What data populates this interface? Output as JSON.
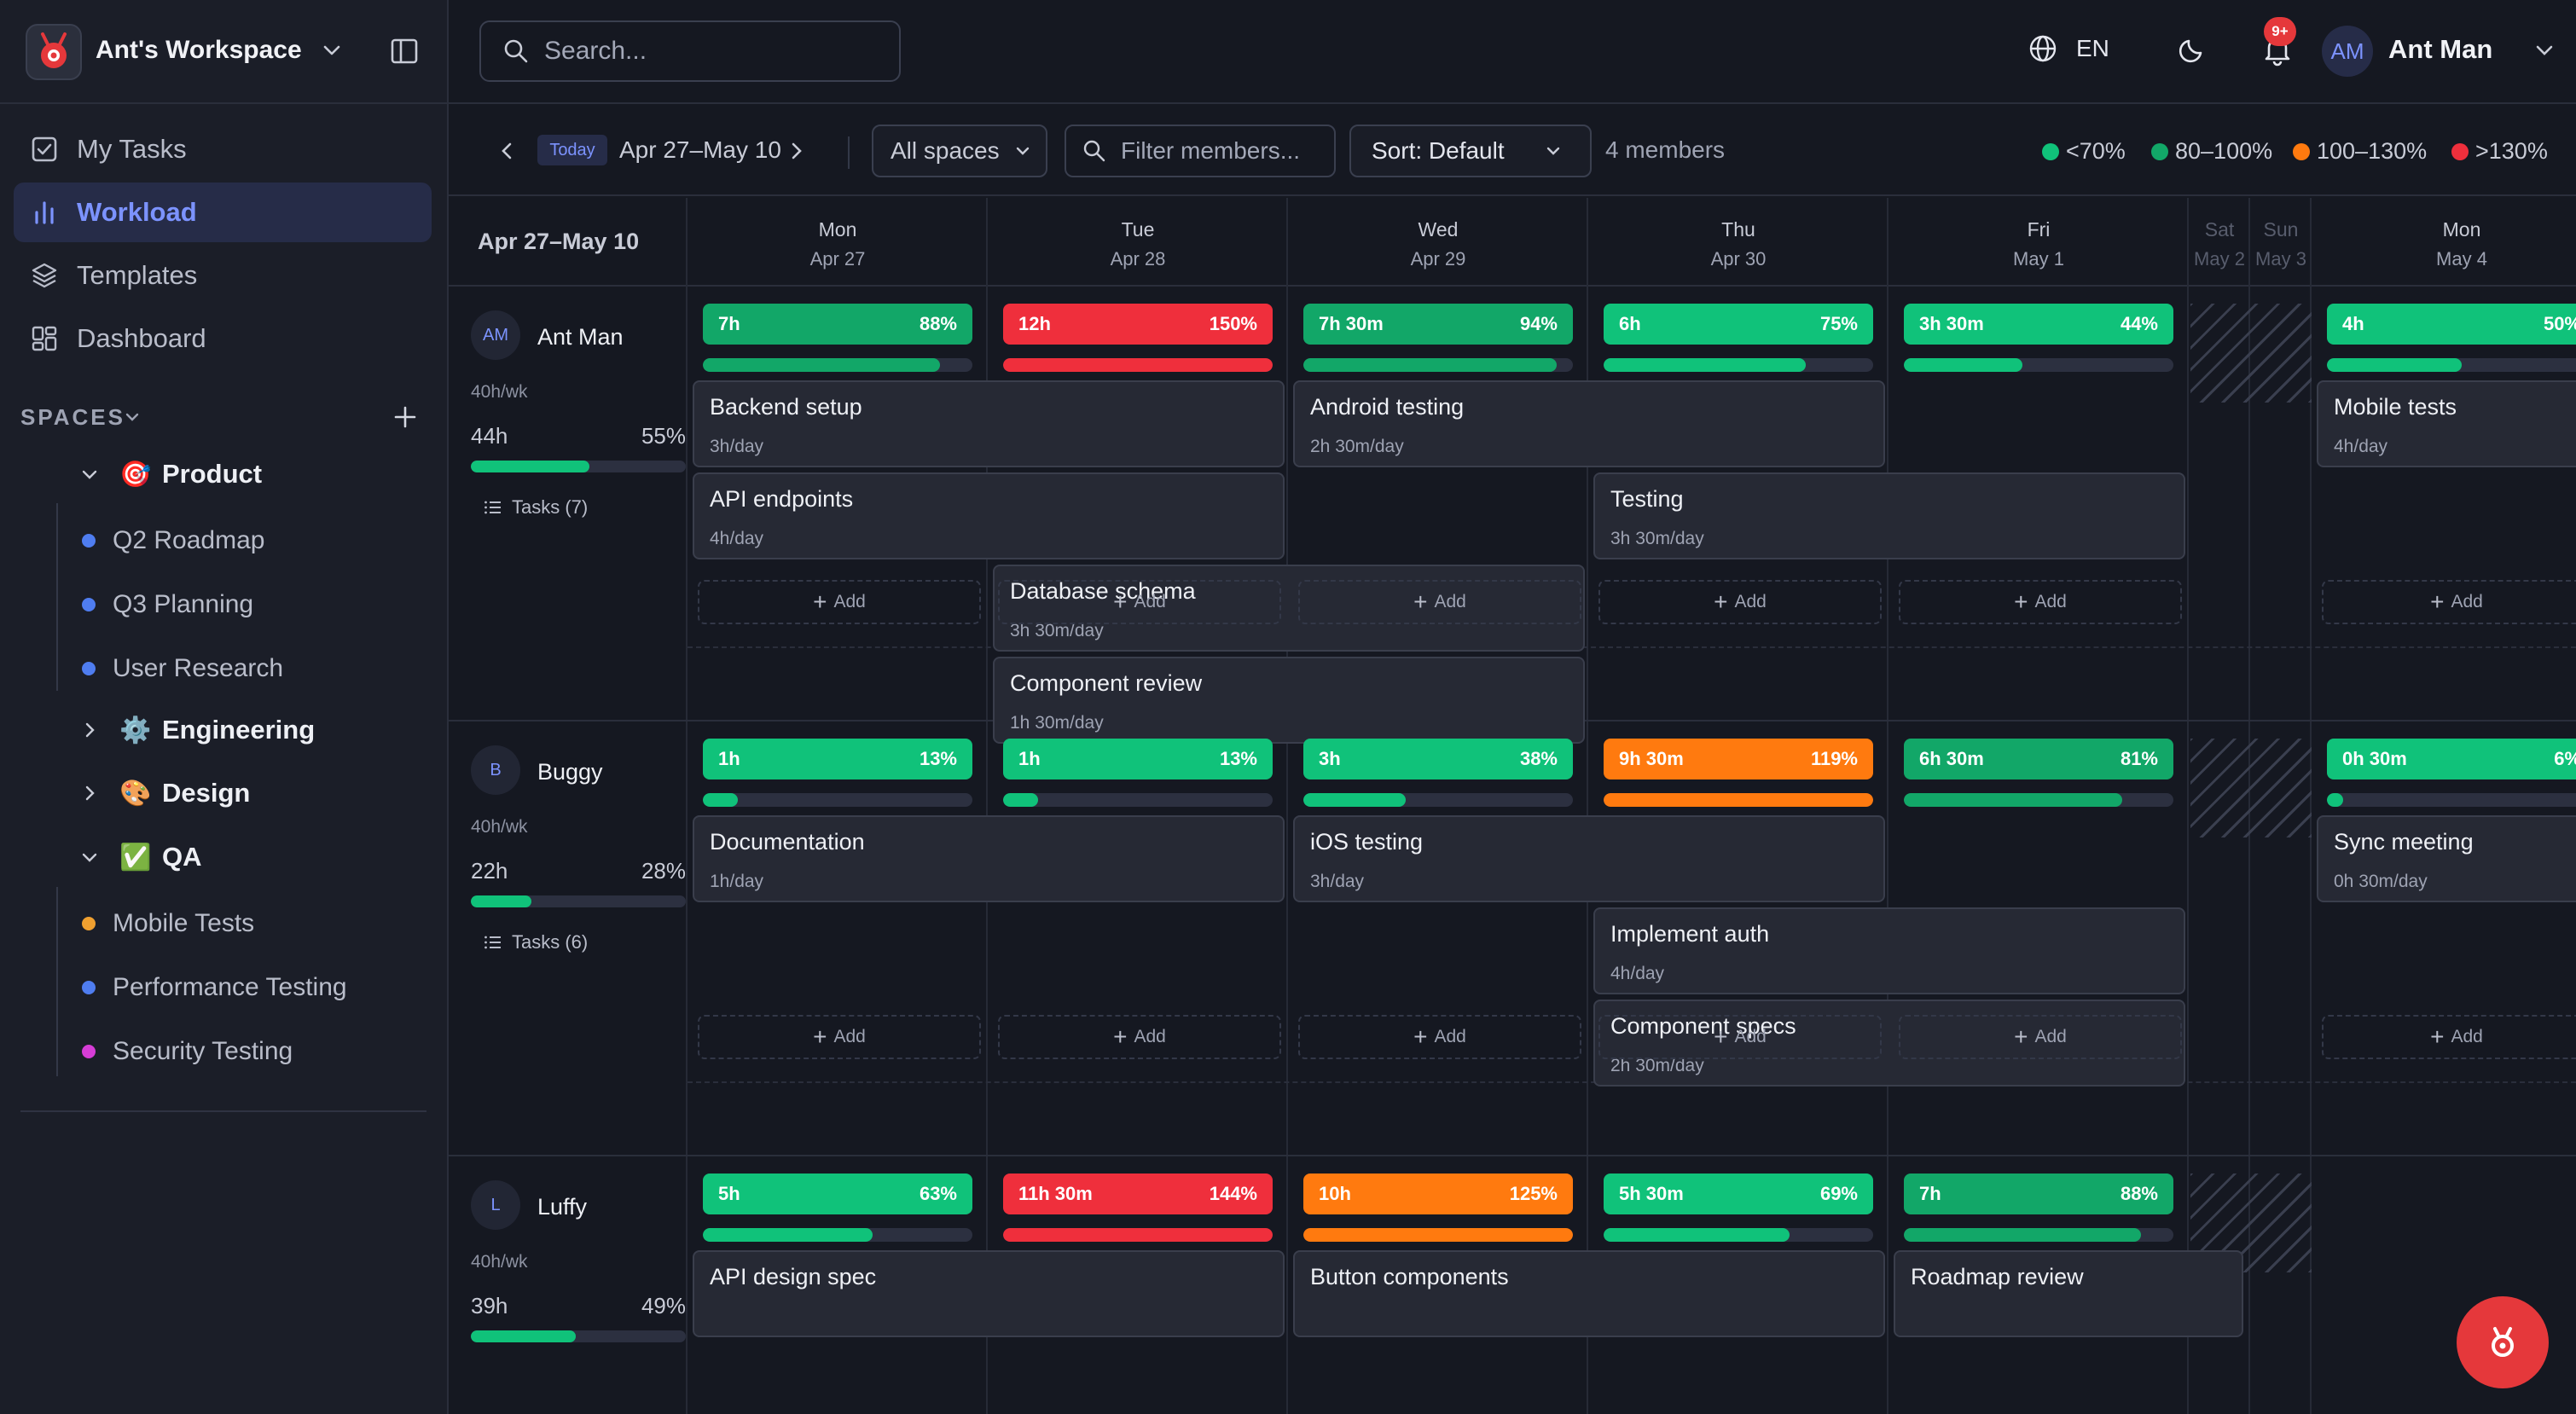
{
  "app": {
    "workspace_name": "Ant's Workspace"
  },
  "nav": [
    {
      "label": "My Tasks",
      "icon": "checkbox-icon"
    },
    {
      "label": "Workload",
      "icon": "bar-chart-icon",
      "active": true
    },
    {
      "label": "Templates",
      "icon": "layers-icon"
    },
    {
      "label": "Dashboard",
      "icon": "dashboard-icon"
    }
  ],
  "spaces": {
    "label": "SPACES",
    "product": {
      "label": "Product",
      "emoji": "🎯",
      "items": [
        {
          "label": "Q2 Roadmap",
          "color": "#4f7df0"
        },
        {
          "label": "Q3 Planning",
          "color": "#4f7df0"
        },
        {
          "label": "User Research",
          "color": "#4f7df0"
        }
      ]
    },
    "engineering": {
      "label": "Engineering",
      "emoji": "⚙️"
    },
    "design": {
      "label": "Design",
      "emoji": "🎨"
    },
    "qa": {
      "label": "QA",
      "emoji": "✅",
      "items": [
        {
          "label": "Mobile Tests",
          "color": "#f0a030"
        },
        {
          "label": "Performance Testing",
          "color": "#4f7df0"
        },
        {
          "label": "Security Testing",
          "color": "#d63dd6"
        }
      ]
    }
  },
  "search": {
    "placeholder": "Search..."
  },
  "topbar": {
    "lang": "EN",
    "notif_badge": "9+",
    "user_initials": "AM",
    "user_name": "Ant Man"
  },
  "toolbar": {
    "today": "Today",
    "range": "Apr 27–May 10",
    "spaces_filter": "All spaces",
    "member_filter_placeholder": "Filter members...",
    "sort": "Sort: Default",
    "members_count": "4 members"
  },
  "legend": [
    {
      "label": "<70%",
      "color": "#10c27a"
    },
    {
      "label": "80–100%",
      "color": "#12a768"
    },
    {
      "label": "100–130%",
      "color": "#ff7a0f"
    },
    {
      "label": ">130%",
      "color": "#ef2f3c"
    }
  ],
  "grid_header": {
    "range": "Apr 27–May 10"
  },
  "days": [
    {
      "day": "Mon",
      "date": "Apr 27"
    },
    {
      "day": "Tue",
      "date": "Apr 28"
    },
    {
      "day": "Wed",
      "date": "Apr 29"
    },
    {
      "day": "Thu",
      "date": "Apr 30"
    },
    {
      "day": "Fri",
      "date": "May 1"
    },
    {
      "day": "Sat",
      "date": "May 2"
    },
    {
      "day": "Sun",
      "date": "May 3"
    },
    {
      "day": "Mon",
      "date": "May 4"
    }
  ],
  "add_label": "Add",
  "people": [
    {
      "initials": "AM",
      "name": "Ant Man",
      "capacity": "40h/wk",
      "hours": "44h",
      "pct": "55%",
      "pct_value": 55,
      "tasks": "Tasks (7)",
      "caps": [
        {
          "h": "7h",
          "p": "88%",
          "v": 88,
          "c": "#12a768"
        },
        {
          "h": "12h",
          "p": "150%",
          "v": 100,
          "c": "#ef2f3c"
        },
        {
          "h": "7h 30m",
          "p": "94%",
          "v": 94,
          "c": "#12a768"
        },
        {
          "h": "6h",
          "p": "75%",
          "v": 75,
          "c": "#10c27a"
        },
        {
          "h": "3h 30m",
          "p": "44%",
          "v": 44,
          "c": "#10c27a"
        },
        {
          "h": "4h",
          "p": "50%",
          "v": 50,
          "c": "#10c27a"
        }
      ],
      "tasks_list": [
        {
          "title": "Backend setup",
          "sub": "3h/day"
        },
        {
          "title": "API endpoints",
          "sub": "4h/day"
        },
        {
          "title": "Database schema",
          "sub": "3h 30m/day"
        },
        {
          "title": "Component review",
          "sub": "1h 30m/day"
        },
        {
          "title": "Android testing",
          "sub": "2h 30m/day"
        },
        {
          "title": "Testing",
          "sub": "3h 30m/day"
        },
        {
          "title": "Mobile tests",
          "sub": "4h/day"
        }
      ]
    },
    {
      "initials": "B",
      "name": "Buggy",
      "capacity": "40h/wk",
      "hours": "22h",
      "pct": "28%",
      "pct_value": 28,
      "tasks": "Tasks (6)",
      "caps": [
        {
          "h": "1h",
          "p": "13%",
          "v": 13,
          "c": "#10c27a"
        },
        {
          "h": "1h",
          "p": "13%",
          "v": 13,
          "c": "#10c27a"
        },
        {
          "h": "3h",
          "p": "38%",
          "v": 38,
          "c": "#10c27a"
        },
        {
          "h": "9h 30m",
          "p": "119%",
          "v": 100,
          "c": "#ff7a0f"
        },
        {
          "h": "6h 30m",
          "p": "81%",
          "v": 81,
          "c": "#12a768"
        },
        {
          "h": "0h 30m",
          "p": "6%",
          "v": 6,
          "c": "#10c27a"
        }
      ],
      "tasks_list": [
        {
          "title": "Documentation",
          "sub": "1h/day"
        },
        {
          "title": "iOS testing",
          "sub": "3h/day"
        },
        {
          "title": "Implement auth",
          "sub": "4h/day"
        },
        {
          "title": "Component specs",
          "sub": "2h 30m/day"
        },
        {
          "title": "Sync meeting",
          "sub": "0h 30m/day"
        }
      ]
    },
    {
      "initials": "L",
      "name": "Luffy",
      "capacity": "40h/wk",
      "hours": "39h",
      "pct": "49%",
      "pct_value": 49,
      "caps": [
        {
          "h": "5h",
          "p": "63%",
          "v": 63,
          "c": "#10c27a"
        },
        {
          "h": "11h 30m",
          "p": "144%",
          "v": 100,
          "c": "#ef2f3c"
        },
        {
          "h": "10h",
          "p": "125%",
          "v": 100,
          "c": "#ff7a0f"
        },
        {
          "h": "5h 30m",
          "p": "69%",
          "v": 69,
          "c": "#10c27a"
        },
        {
          "h": "7h",
          "p": "88%",
          "v": 88,
          "c": "#12a768"
        }
      ],
      "tasks_list": [
        {
          "title": "API design spec",
          "sub": ""
        },
        {
          "title": "Button components",
          "sub": ""
        },
        {
          "title": "Roadmap review",
          "sub": ""
        }
      ]
    }
  ]
}
